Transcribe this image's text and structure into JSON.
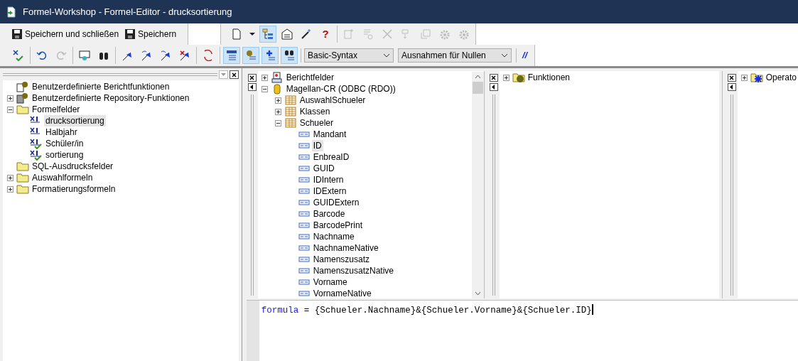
{
  "window": {
    "title": "Formel-Workshop - Formel-Editor - drucksortierung"
  },
  "toolbar_top": {
    "text_buttons": [
      {
        "label": "Speichern und schließen"
      },
      {
        "label": "Speichern"
      }
    ],
    "icon_groups": [
      [
        {
          "kind": "new-page",
          "selected": false,
          "disabled": false
        },
        {
          "kind": "caret",
          "selected": false,
          "disabled": false
        },
        {
          "kind": "tree",
          "selected": true,
          "disabled": false
        },
        {
          "kind": "properties",
          "selected": false,
          "disabled": false
        },
        {
          "kind": "wand",
          "selected": false,
          "disabled": false
        },
        {
          "kind": "help",
          "label": "?",
          "selected": false,
          "disabled": false
        }
      ],
      [
        {
          "kind": "new-item",
          "selected": false,
          "disabled": true
        },
        {
          "kind": "rename",
          "selected": false,
          "disabled": true
        },
        {
          "kind": "delete",
          "selected": false,
          "disabled": true
        },
        {
          "kind": "step",
          "selected": false,
          "disabled": true
        },
        {
          "kind": "jump",
          "selected": false,
          "disabled": true
        },
        {
          "kind": "gear",
          "selected": false,
          "disabled": true
        },
        {
          "kind": "gear",
          "selected": false,
          "disabled": true
        }
      ]
    ]
  },
  "toolbar_bottom": {
    "icon_groups": [
      [
        {
          "kind": "check",
          "selected": false,
          "disabled": false
        }
      ],
      [
        {
          "kind": "undo",
          "selected": false,
          "disabled": false
        },
        {
          "kind": "redo",
          "selected": false,
          "disabled": true
        }
      ],
      [
        {
          "kind": "comment",
          "selected": false,
          "disabled": false
        },
        {
          "kind": "binoculars",
          "selected": false,
          "disabled": false
        }
      ],
      [
        {
          "kind": "flag",
          "selected": false,
          "disabled": false
        },
        {
          "kind": "flag-next",
          "selected": false,
          "disabled": false
        },
        {
          "kind": "flag-prev",
          "selected": false,
          "disabled": false
        },
        {
          "kind": "flag-clear",
          "selected": false,
          "disabled": false
        }
      ],
      [
        {
          "kind": "sort",
          "selected": false,
          "disabled": false
        }
      ],
      [
        {
          "kind": "list",
          "selected": true,
          "disabled": false
        },
        {
          "kind": "gear-list",
          "selected": true,
          "disabled": false
        },
        {
          "kind": "plus-list",
          "selected": true,
          "disabled": false
        },
        {
          "kind": "binoc-list",
          "selected": true,
          "disabled": false
        }
      ]
    ],
    "syntax_select": {
      "value": "Basic-Syntax"
    },
    "null_select": {
      "value": "Ausnahmen für Nullen"
    },
    "comment_button": {
      "label": "//"
    }
  },
  "workshop_tree": [
    {
      "label": "Benutzerdefinierte Berichtfunktionen",
      "kind": "report-gear",
      "selected": false
    },
    {
      "label": "Benutzerdefinierte Repository-Funktionen",
      "kind": "repo-gear",
      "expanded": false,
      "selected": false
    },
    {
      "label": "Formelfelder",
      "kind": "folder",
      "expanded": true,
      "selected": false,
      "children": [
        {
          "label": "drucksortierung",
          "kind": "formula",
          "selected": true
        },
        {
          "label": "Halbjahr",
          "kind": "formula",
          "selected": false
        },
        {
          "label": "Schüler/in",
          "kind": "formula-checked",
          "selected": false
        },
        {
          "label": "sortierung",
          "kind": "formula-checked",
          "selected": false
        }
      ]
    },
    {
      "label": "SQL-Ausdrucksfelder",
      "kind": "folder",
      "selected": false
    },
    {
      "label": "Auswahlformeln",
      "kind": "folder",
      "expanded": false,
      "selected": false
    },
    {
      "label": "Formatierungsformeln",
      "kind": "folder",
      "expanded": false,
      "selected": false
    }
  ],
  "field_tree": [
    {
      "label": "Berichtfelder",
      "kind": "report",
      "expanded": false,
      "selected": false
    },
    {
      "label": "Magellan-CR (ODBC (RDO))",
      "kind": "database",
      "expanded": true,
      "selected": false,
      "children": [
        {
          "label": "AuswahlSchueler",
          "kind": "table",
          "expanded": false,
          "selected": false
        },
        {
          "label": "Klassen",
          "kind": "table",
          "expanded": false,
          "selected": false
        },
        {
          "label": "Schueler",
          "kind": "table",
          "expanded": true,
          "selected": false,
          "children": [
            {
              "label": "Mandant",
              "kind": "field",
              "selected": false
            },
            {
              "label": "ID",
              "kind": "field",
              "selected": true
            },
            {
              "label": "EnbreaID",
              "kind": "field",
              "selected": false
            },
            {
              "label": "GUID",
              "kind": "field",
              "selected": false
            },
            {
              "label": "IDIntern",
              "kind": "field",
              "selected": false
            },
            {
              "label": "IDExtern",
              "kind": "field",
              "selected": false
            },
            {
              "label": "GUIDExtern",
              "kind": "field",
              "selected": false
            },
            {
              "label": "Barcode",
              "kind": "field",
              "selected": false
            },
            {
              "label": "BarcodePrint",
              "kind": "field",
              "selected": false
            },
            {
              "label": "Nachname",
              "kind": "field",
              "selected": false
            },
            {
              "label": "NachnameNative",
              "kind": "field",
              "selected": false
            },
            {
              "label": "Namenszusatz",
              "kind": "field",
              "selected": false
            },
            {
              "label": "NamenszusatzNative",
              "kind": "field",
              "selected": false
            },
            {
              "label": "Vorname",
              "kind": "field",
              "selected": false
            },
            {
              "label": "VornameNative",
              "kind": "field",
              "selected": false
            }
          ]
        }
      ]
    }
  ],
  "function_tree": [
    {
      "label": "Funktionen",
      "kind": "functions",
      "expanded": false,
      "selected": false
    }
  ],
  "operator_tree": [
    {
      "label": "Operato",
      "kind": "operators",
      "expanded": false,
      "selected": false
    }
  ],
  "editor": {
    "keyword": "formula",
    "text": " = {Schueler.Nachname}&{Schueler.Vorname}&{Schueler.ID}"
  }
}
